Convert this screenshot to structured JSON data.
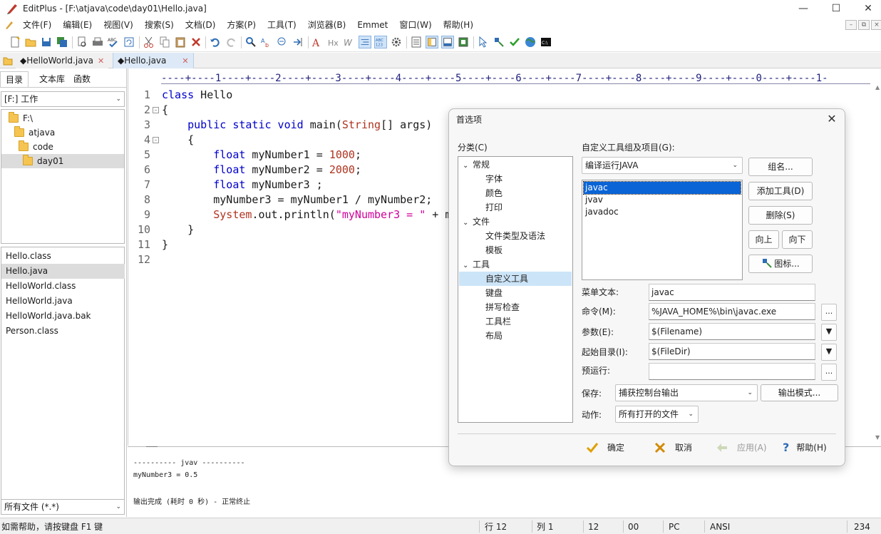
{
  "window": {
    "title": "EditPlus - [F:\\atjava\\code\\day01\\Hello.java]"
  },
  "menu": [
    "文件(F)",
    "编辑(E)",
    "视图(V)",
    "搜索(S)",
    "文档(D)",
    "方案(P)",
    "工具(T)",
    "浏览器(B)",
    "Emmet",
    "窗口(W)",
    "帮助(H)"
  ],
  "tabs": [
    {
      "label": "◆HelloWorld.java"
    },
    {
      "label": "◆Hello.java"
    }
  ],
  "left": {
    "tabs": [
      "目录",
      "文本库",
      "函数"
    ],
    "drive": "[F:] 工作",
    "tree": [
      "F:\\",
      "atjava",
      "code",
      "day01"
    ],
    "files": [
      "Hello.class",
      "Hello.java",
      "HelloWorld.class",
      "HelloWorld.java",
      "HelloWorld.java.bak",
      "Person.class"
    ],
    "filter": "所有文件 (*.*)"
  },
  "editor": {
    "ruler": "----+----1----+----2----+----3----+----4----+----5----+----6----+----7----+----8----+----9----+----0----+----1-",
    "line_numbers": [
      "1",
      "2",
      "3",
      "4",
      "5",
      "6",
      "7",
      "8",
      "9",
      "10",
      "11",
      "12"
    ],
    "lines": [
      [
        "class Hello"
      ],
      [
        "{"
      ],
      [
        "    public static void main(String[] args)"
      ],
      [
        "    {"
      ],
      [
        "        float myNumber1 = 1000;"
      ],
      [
        "        float myNumber2 = 2000;"
      ],
      [
        "        float myNumber3 ;"
      ],
      [
        "        myNumber3 = myNumber1 / myNumber2;"
      ],
      [
        "        System.out.println(\"myNumber3 = \" + m"
      ],
      [
        "    }"
      ],
      [
        "}"
      ],
      [
        ""
      ]
    ]
  },
  "output": {
    "lines": [
      "---------- jvav ----------",
      "myNumber3 = 0.5",
      "",
      "输出完成 (耗时 0 秒) - 正常终止"
    ]
  },
  "status": {
    "help": "如需帮助，请按键盘 F1 键",
    "row": "行 12",
    "col": "列 1",
    "c1": "12",
    "c2": "00",
    "mode": "PC",
    "enc": "ANSI",
    "size": "234"
  },
  "dialog": {
    "title": "首选项",
    "category_label": "分类(C)",
    "categories": [
      {
        "label": "常规",
        "level": 0,
        "expanded": true
      },
      {
        "label": "字体",
        "level": 1
      },
      {
        "label": "颜色",
        "level": 1
      },
      {
        "label": "打印",
        "level": 1
      },
      {
        "label": "文件",
        "level": 0,
        "expanded": true
      },
      {
        "label": "文件类型及语法",
        "level": 1
      },
      {
        "label": "模板",
        "level": 1
      },
      {
        "label": "工具",
        "level": 0,
        "expanded": true
      },
      {
        "label": "自定义工具",
        "level": 1,
        "selected": true
      },
      {
        "label": "键盘",
        "level": 1
      },
      {
        "label": "拼写检查",
        "level": 1
      },
      {
        "label": "工具栏",
        "level": 1
      },
      {
        "label": "布局",
        "level": 1
      }
    ],
    "group_label": "自定义工具组及项目(G):",
    "group_value": "编译运行JAVA",
    "tools": [
      "javac",
      "jvav",
      "javadoc"
    ],
    "selected_tool": "javac",
    "buttons": {
      "group_name": "组名...",
      "add_tool": "添加工具(D)",
      "delete": "删除(S)",
      "up": "向上",
      "down": "向下",
      "icon": "图标..."
    },
    "menu_text_label": "菜单文本:",
    "menu_text": "javac",
    "command_label": "命令(M):",
    "command": "%JAVA_HOME%\\bin\\javac.exe",
    "args_label": "参数(E):",
    "args": "$(Filename)",
    "dir_label": "起始目录(I):",
    "dir": "$(FileDir)",
    "prerun_label": "预运行:",
    "prerun": "",
    "save_label": "保存:",
    "save_value": "捕获控制台输出",
    "output_mode": "输出模式...",
    "action_label": "动作:",
    "action_value": "所有打开的文件",
    "ok": "确定",
    "cancel": "取消",
    "apply": "应用(A)",
    "help": "帮助(H)",
    "ellipsis": "...",
    "ok_color": "#e0a000",
    "cancel_color": "#d28a00"
  }
}
